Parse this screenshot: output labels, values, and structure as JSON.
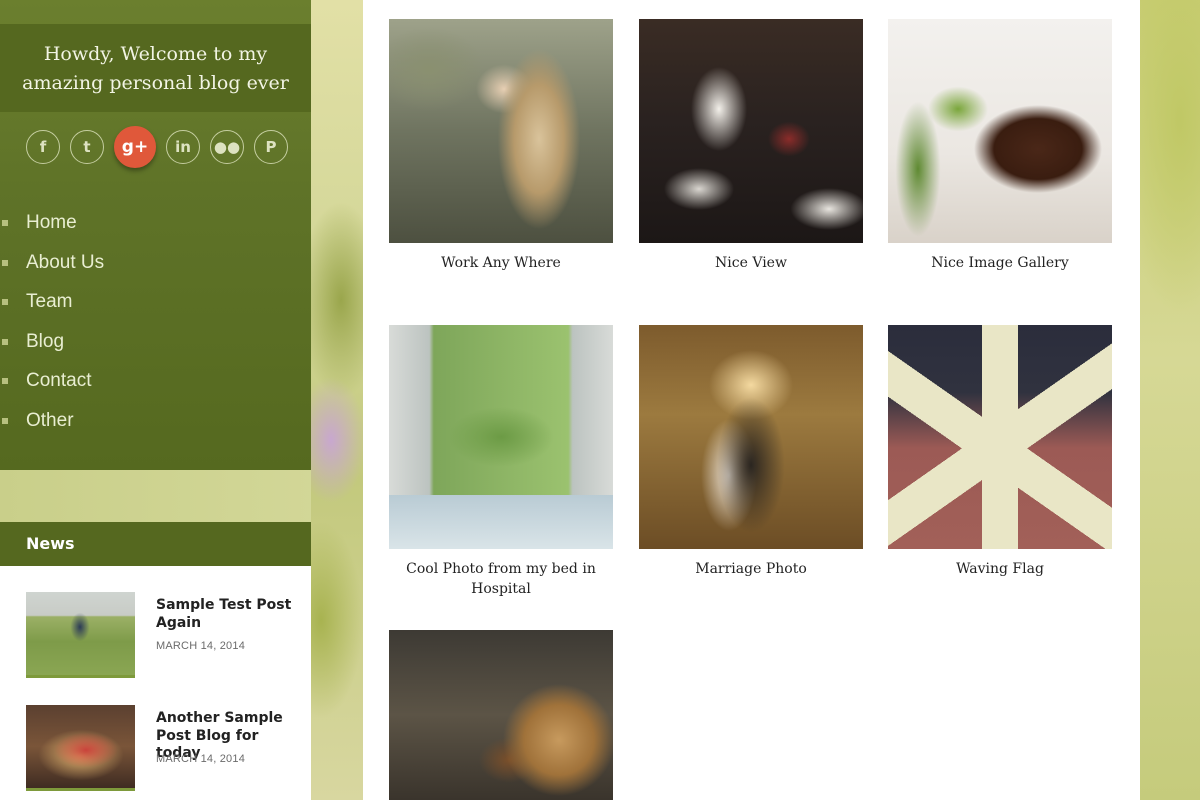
{
  "sidebar": {
    "welcome_line1": "Howdy, Welcome to my",
    "welcome_line2": "amazing personal blog ever",
    "socials": [
      {
        "icon": "facebook-icon",
        "glyph": "f"
      },
      {
        "icon": "twitter-icon",
        "glyph": "t"
      },
      {
        "icon": "google-plus-icon",
        "glyph": "g+",
        "active": true,
        "color": "#e0583a"
      },
      {
        "icon": "linkedin-icon",
        "glyph": "in"
      },
      {
        "icon": "flickr-icon",
        "glyph": "●●"
      },
      {
        "icon": "pinterest-icon",
        "glyph": "P"
      }
    ],
    "nav": [
      "Home",
      "About Us",
      "Team",
      "Blog",
      "Contact",
      "Other"
    ],
    "news_title": "News",
    "news": [
      {
        "title": "Sample Test Post Again",
        "date": "MARCH 14, 2014"
      },
      {
        "title": "Another Sample Post Blog for today",
        "date": "MARCH 14, 2014"
      }
    ]
  },
  "gallery": [
    {
      "caption": "Work Any Where"
    },
    {
      "caption": "Nice View"
    },
    {
      "caption": "Nice Image Gallery"
    },
    {
      "caption": "Cool Photo from my bed in Hospital"
    },
    {
      "caption": "Marriage Photo"
    },
    {
      "caption": "Waving Flag"
    },
    {
      "caption": ""
    }
  ],
  "colors": {
    "sidebar_green": "#5f7328",
    "header_green": "#55681f",
    "accent_red": "#e0583a"
  }
}
